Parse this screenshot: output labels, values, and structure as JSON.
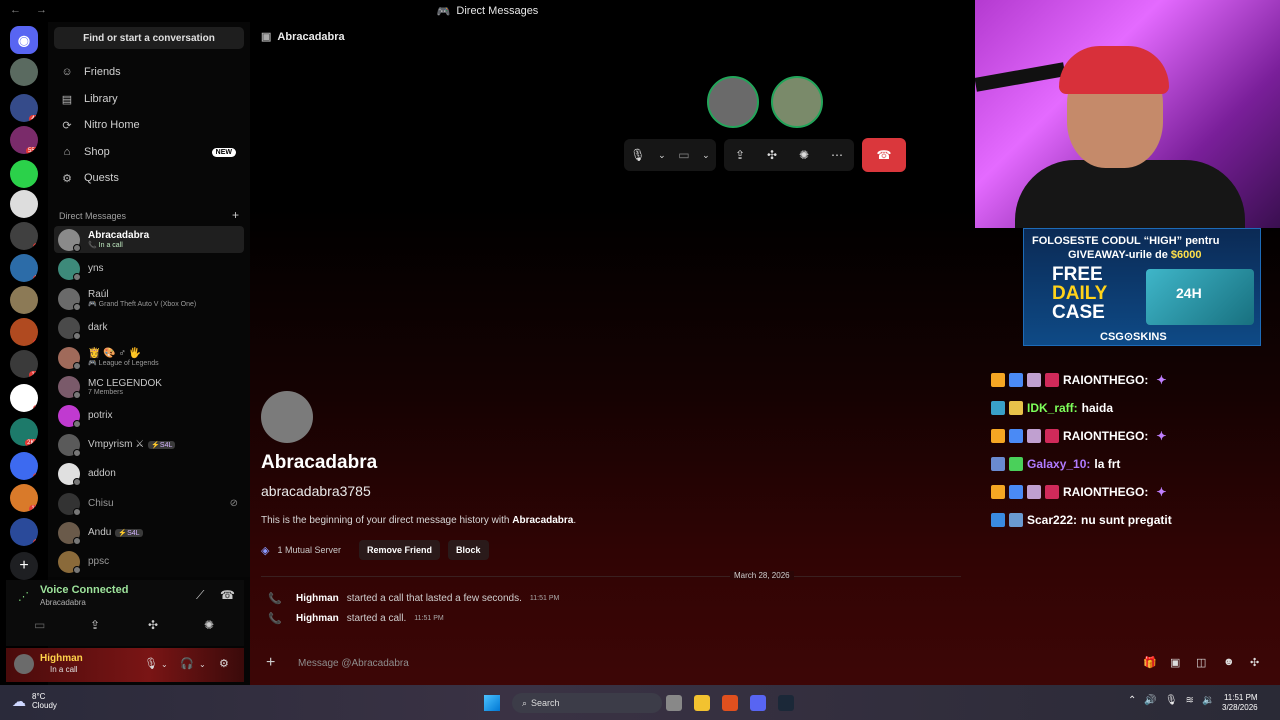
{
  "window": {
    "title": "Direct Messages",
    "nav": "← →"
  },
  "sidebar": {
    "search_label": "Find or start a conversation",
    "nav": [
      {
        "label": "Friends",
        "icon": "person-wave-icon"
      },
      {
        "label": "Library",
        "icon": "library-icon"
      },
      {
        "label": "Nitro Home",
        "icon": "nitro-icon"
      },
      {
        "label": "Shop",
        "icon": "shop-icon",
        "badge": "NEW"
      },
      {
        "label": "Quests",
        "icon": "quests-icon"
      }
    ],
    "dm_header": "Direct Messages",
    "dm_add": "+",
    "dms": [
      {
        "name": "Abracadabra",
        "sub": "In a call",
        "active": true
      },
      {
        "name": "yns",
        "sub": ""
      },
      {
        "name": "Raúl",
        "sub": "Grand Theft Auto V (Xbox One)"
      },
      {
        "name": "dark",
        "sub": ""
      },
      {
        "name": "👸 🎨 ♂ 🖐",
        "sub": "League of Legends"
      },
      {
        "name": "MC LEGENDOK",
        "sub": "7 Members"
      },
      {
        "name": "potrix",
        "sub": ""
      },
      {
        "name": "Vmpyrism ⚔",
        "sub": "",
        "tag": "⚡S4L"
      },
      {
        "name": "addon",
        "sub": ""
      },
      {
        "name": "Chisu",
        "sub": ""
      },
      {
        "name": "Andu",
        "sub": "",
        "tag": "⚡S4L"
      },
      {
        "name": "ppsc",
        "sub": ""
      }
    ]
  },
  "voice": {
    "status": "Voice Connected",
    "channel": "Abracadabra"
  },
  "user": {
    "name": "Highman",
    "status": "In a call"
  },
  "main": {
    "channel_name": "Abracadabra",
    "profile": {
      "display_name": "Abracadabra",
      "username": "abracadabra3785",
      "intro_prefix": "This is the beginning of your direct message history with ",
      "intro_name": "Abracadabra",
      "intro_suffix": ".",
      "mutual": "1 Mutual Server",
      "remove_friend": "Remove Friend",
      "block": "Block"
    },
    "date_divider": "March 28, 2026",
    "messages": [
      {
        "author": "Highman",
        "text": "started a call that lasted a few seconds.",
        "time": "11:51 PM"
      },
      {
        "author": "Highman",
        "text": "started a call.",
        "time": "11:51 PM"
      }
    ],
    "composer_placeholder": "Message @Abracadabra"
  },
  "overlay": {
    "promo_line1_a": "FOLOSESTE CODUL ",
    "promo_line1_code": "“HIGH”",
    "promo_line1_b": " pentru",
    "promo_line2_a": "GIVEAWAY-urile de ",
    "promo_line2_amount": "$6000",
    "promo_free": "FREE",
    "promo_daily": "DAILY",
    "promo_case": "CASE",
    "promo_box": "24H",
    "promo_brand": "CSG⊙SKINS",
    "chat": [
      {
        "user": "RAIONTHEGO:",
        "msg": "",
        "color": "#ffffff"
      },
      {
        "user": "IDK_raff:",
        "msg": "haida",
        "color": "#7dff5a"
      },
      {
        "user": "RAIONTHEGO:",
        "msg": "",
        "color": "#ffffff"
      },
      {
        "user": "Galaxy_10:",
        "msg": "la frt",
        "color": "#b07bff"
      },
      {
        "user": "RAIONTHEGO:",
        "msg": "",
        "color": "#ffffff"
      },
      {
        "user": "Scar222:",
        "msg": "nu sunt pregatit",
        "color": "#ffffff"
      }
    ]
  },
  "taskbar": {
    "temp": "8°C",
    "weather": "Cloudy",
    "search": "Search",
    "time": "11:51 PM",
    "date": "3/28/2026"
  },
  "colors": {
    "accent": "#5865f2",
    "hangup": "#da373c",
    "online": "#23a55a"
  }
}
